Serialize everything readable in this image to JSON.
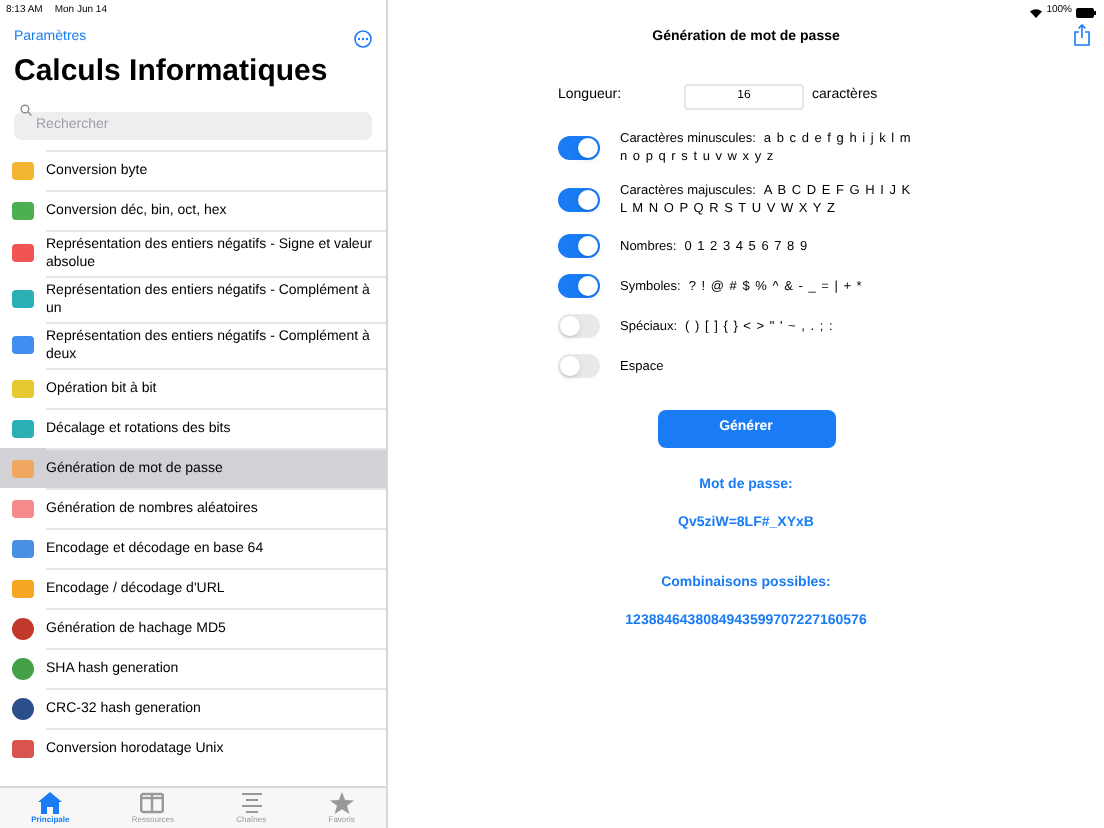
{
  "status_bar": {
    "time": "8:13 AM",
    "date": "Mon Jun 14",
    "battery": "100%"
  },
  "sidebar": {
    "back_link": "Paramètres",
    "title": "Calculs Informatiques",
    "search": {
      "placeholder": "Rechercher"
    },
    "items": [
      {
        "label": "Conversion byte",
        "color": "#f2b632",
        "kind": "square",
        "selected": false
      },
      {
        "label": "Conversion déc, bin, oct, hex",
        "color": "#4caf50",
        "kind": "square",
        "selected": false
      },
      {
        "label": "Représentation des entiers négatifs - Signe et valeur absolue",
        "color": "#f05454",
        "kind": "square",
        "selected": false
      },
      {
        "label": "Représentation des entiers négatifs - Complément à un",
        "color": "#2bb0b5",
        "kind": "square",
        "selected": false
      },
      {
        "label": "Représentation des entiers négatifs - Complément à deux",
        "color": "#3f8ef0",
        "kind": "square",
        "selected": false
      },
      {
        "label": "Opération bit à bit",
        "color": "#e6c830",
        "kind": "square",
        "selected": false
      },
      {
        "label": "Décalage et rotations des bits",
        "color": "#2bb0b5",
        "kind": "square",
        "selected": false
      },
      {
        "label": "Génération de mot de passe",
        "color": "#f0a860",
        "kind": "square",
        "selected": true
      },
      {
        "label": "Génération de nombres aléatoires",
        "color": "#f58a8a",
        "kind": "square",
        "selected": false
      },
      {
        "label": "Encodage et décodage en base 64",
        "color": "#4a90e2",
        "kind": "square",
        "selected": false
      },
      {
        "label": "Encodage / décodage d'URL",
        "color": "#f5a623",
        "kind": "square",
        "selected": false
      },
      {
        "label": "Génération de hachage MD5",
        "color": "#c0392b",
        "kind": "circle",
        "selected": false
      },
      {
        "label": "SHA hash generation",
        "color": "#43a047",
        "kind": "circle",
        "selected": false
      },
      {
        "label": "CRC-32 hash generation",
        "color": "#2c4f8a",
        "kind": "circle",
        "selected": false
      },
      {
        "label": "Conversion horodatage Unix",
        "color": "#d9534f",
        "kind": "square",
        "selected": false
      }
    ]
  },
  "tab_bar": [
    {
      "label": "Principale",
      "selected": true
    },
    {
      "label": "Ressources",
      "selected": false
    },
    {
      "label": "Chaînes",
      "selected": false
    },
    {
      "label": "Favoris",
      "selected": false
    }
  ],
  "detail": {
    "title": "Génération de mot de passe",
    "length": {
      "label": "Longueur:",
      "value": "16",
      "unit": "caractères"
    },
    "options": [
      {
        "label": "Caractères minuscules:",
        "chars": "a b c d e f g h i j k l m n o p q r s t u v w x y z",
        "on": true
      },
      {
        "label": "Caractères majuscules:",
        "chars": "A B C D E F G H I J K L M N O P Q R S T U V W X Y Z",
        "on": true
      },
      {
        "label": "Nombres:",
        "chars": "0 1 2 3 4 5 6 7 8 9",
        "on": true
      },
      {
        "label": "Symboles:",
        "chars": "? ! @ # $ % ^ & - _ = | + *",
        "on": true
      },
      {
        "label": "Spéciaux:",
        "chars": "( ) [ ] { } < > \" ' ~ , . ; :",
        "on": false
      },
      {
        "label": "Espace",
        "on": false
      }
    ],
    "button": "Générer",
    "password_label": "Mot de passe:",
    "password": "Qv5ziW=8LF#_XYxB",
    "combinations_label": "Combinaisons possibles:",
    "combinations": "1238846438084943599707227160576"
  }
}
